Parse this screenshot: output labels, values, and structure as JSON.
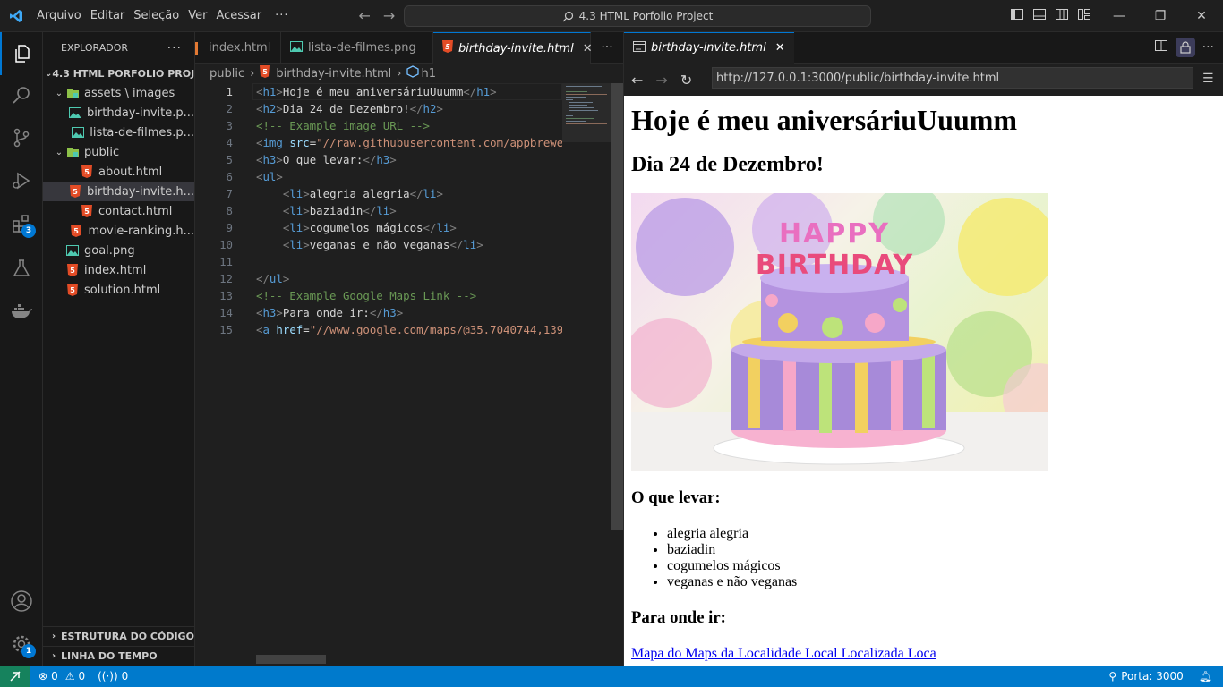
{
  "menu": [
    "Arquivo",
    "Editar",
    "Seleção",
    "Ver",
    "Acessar"
  ],
  "command_center": "4.3 HTML Porfolio Project",
  "activity_badges": {
    "extensions": "3",
    "settings": "1"
  },
  "sidebar": {
    "title": "EXPLORADOR",
    "root": "4.3 HTML PORFOLIO PROJ...",
    "items": [
      {
        "label": "assets \\ images",
        "kind": "folder",
        "depth": 1
      },
      {
        "label": "birthday-invite.p...",
        "kind": "image",
        "depth": 2
      },
      {
        "label": "lista-de-filmes.p...",
        "kind": "image",
        "depth": 2
      },
      {
        "label": "public",
        "kind": "folder",
        "depth": 1
      },
      {
        "label": "about.html",
        "kind": "html",
        "depth": 2
      },
      {
        "label": "birthday-invite.h...",
        "kind": "html",
        "depth": 2,
        "selected": true
      },
      {
        "label": "contact.html",
        "kind": "html",
        "depth": 2
      },
      {
        "label": "movie-ranking.h...",
        "kind": "html",
        "depth": 2
      },
      {
        "label": "goal.png",
        "kind": "image",
        "depth": 1
      },
      {
        "label": "index.html",
        "kind": "html",
        "depth": 1
      },
      {
        "label": "solution.html",
        "kind": "html",
        "depth": 1
      }
    ],
    "outline": "ESTRUTURA DO CÓDIGO",
    "timeline": "LINHA DO TEMPO"
  },
  "editor": {
    "tabs": [
      "index.html",
      "lista-de-filmes.png",
      "birthday-invite.html"
    ],
    "breadcrumb": [
      "public",
      "birthday-invite.html",
      "h1"
    ]
  },
  "code_lines": [
    {
      "n": "1",
      "html": "<span class=\"tag\">&lt;</span><span class=\"tn\">h1</span><span class=\"tag\">&gt;</span>Hoje é meu aniversáriuUuumm<span class=\"tag\">&lt;/</span><span class=\"tn\">h1</span><span class=\"tag\">&gt;</span>"
    },
    {
      "n": "2",
      "html": "<span class=\"tag\">&lt;</span><span class=\"tn\">h2</span><span class=\"tag\">&gt;</span>Dia 24 de Dezembro!<span class=\"tag\">&lt;/</span><span class=\"tn\">h2</span><span class=\"tag\">&gt;</span>"
    },
    {
      "n": "3",
      "html": "<span class=\"cm\">&lt;!-- Example image URL --&gt;</span>"
    },
    {
      "n": "4",
      "html": "<span class=\"tag\">&lt;</span><span class=\"tn\">img</span> <span class=\"at\">src</span>=<span style=\"color:#ce9178\">\"</span><span class=\"str\">//raw.githubusercontent.com/appbrewer</span>"
    },
    {
      "n": "5",
      "html": "<span class=\"tag\">&lt;</span><span class=\"tn\">h3</span><span class=\"tag\">&gt;</span>O que levar:<span class=\"tag\">&lt;/</span><span class=\"tn\">h3</span><span class=\"tag\">&gt;</span>"
    },
    {
      "n": "6",
      "html": "<span class=\"tag\">&lt;</span><span class=\"tn\">ul</span><span class=\"tag\">&gt;</span>"
    },
    {
      "n": "7",
      "html": "    <span class=\"tag\">&lt;</span><span class=\"tn\">li</span><span class=\"tag\">&gt;</span>alegria alegria<span class=\"tag\">&lt;/</span><span class=\"tn\">li</span><span class=\"tag\">&gt;</span>"
    },
    {
      "n": "8",
      "html": "    <span class=\"tag\">&lt;</span><span class=\"tn\">li</span><span class=\"tag\">&gt;</span>baziadin<span class=\"tag\">&lt;/</span><span class=\"tn\">li</span><span class=\"tag\">&gt;</span>"
    },
    {
      "n": "9",
      "html": "    <span class=\"tag\">&lt;</span><span class=\"tn\">li</span><span class=\"tag\">&gt;</span>cogumelos mágicos<span class=\"tag\">&lt;/</span><span class=\"tn\">li</span><span class=\"tag\">&gt;</span>"
    },
    {
      "n": "10",
      "html": "    <span class=\"tag\">&lt;</span><span class=\"tn\">li</span><span class=\"tag\">&gt;</span>veganas e não veganas<span class=\"tag\">&lt;/</span><span class=\"tn\">li</span><span class=\"tag\">&gt;</span>"
    },
    {
      "n": "11",
      "html": ""
    },
    {
      "n": "12",
      "html": "<span class=\"tag\">&lt;/</span><span class=\"tn\">ul</span><span class=\"tag\">&gt;</span>"
    },
    {
      "n": "13",
      "html": "<span class=\"cm\">&lt;!-- Example Google Maps Link --&gt;</span>"
    },
    {
      "n": "14",
      "html": "<span class=\"tag\">&lt;</span><span class=\"tn\">h3</span><span class=\"tag\">&gt;</span>Para onde ir:<span class=\"tag\">&lt;/</span><span class=\"tn\">h3</span><span class=\"tag\">&gt;</span>"
    },
    {
      "n": "15",
      "html": "<span class=\"tag\">&lt;</span><span class=\"tn\">a</span> <span class=\"at\">href</span>=<span style=\"color:#ce9178\">\"</span><span class=\"str\">//www.google.com/maps/@35.7040744,139</span>"
    }
  ],
  "preview": {
    "tab": "birthday-invite.html",
    "url": "http://127.0.0.1:3000/public/birthday-invite.html",
    "h1": "Hoje é meu aniversáriuUuumm",
    "h2": "Dia 24 de Dezembro!",
    "h3_bring": "O que levar:",
    "list": [
      "alegria alegria",
      "baziadin",
      "cogumelos mágicos",
      "veganas e não veganas"
    ],
    "h3_where": "Para onde ir:",
    "link": "Mapa do Maps da Localidade Local Localizada Loca"
  },
  "status": {
    "errors": "0",
    "warnings": "0",
    "ports": "0",
    "port_label": "Porta: 3000"
  }
}
